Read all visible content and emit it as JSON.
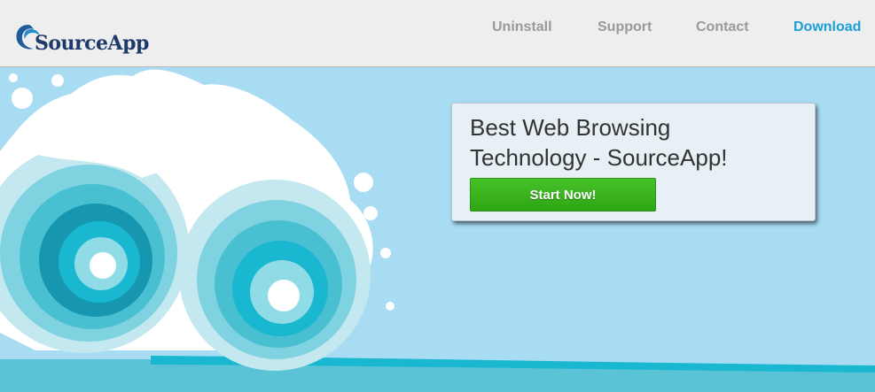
{
  "brand": {
    "name": "SourceApp"
  },
  "nav": {
    "items": [
      {
        "label": "Uninstall",
        "active": false
      },
      {
        "label": "Support",
        "active": false
      },
      {
        "label": "Contact",
        "active": false
      },
      {
        "label": "Download",
        "active": true
      }
    ]
  },
  "promo": {
    "title_line1": "Best Web Browsing",
    "title_line2": "Technology - SourceApp!",
    "cta_label": "Start Now!"
  },
  "colors": {
    "header_bg": "#eeeeee",
    "hero_bg": "#a8dcf3",
    "nav_text": "#9a9a9a",
    "nav_active": "#1ba0d8",
    "brand_text": "#1d3a6b",
    "cta_green": "#3cb81f"
  },
  "icons": {
    "logo": "wave-swoosh-icon",
    "hero_art": "ocean-wave-illustration"
  }
}
